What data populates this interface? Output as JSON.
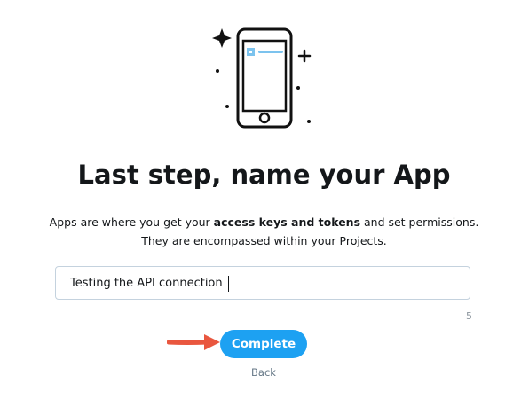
{
  "dialog": {
    "title": "Last step, name your App",
    "description": {
      "part1": "Apps are where you get your ",
      "bold": "access keys and tokens",
      "part2": " and set permissions.",
      "line2": "They are encompassed within your Projects."
    },
    "app_name_input": {
      "value": "Testing the API connection"
    },
    "char_count": "5",
    "complete_label": "Complete",
    "back_label": "Back"
  },
  "colors": {
    "accent": "#1da1f2",
    "text": "#14171a",
    "muted": "#657786",
    "arrow": "#e9573f"
  },
  "icons": {
    "illustration": "smartphone-icon",
    "arrow": "red-arrow-icon"
  }
}
